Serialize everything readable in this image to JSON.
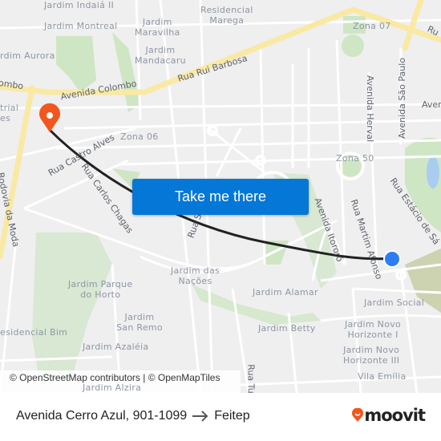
{
  "map": {
    "labels": {
      "indaia": "Jardim Indaiá II",
      "montreal": "Jardim Montreal",
      "maravilha": "Jardim\nMaravilha",
      "mandacaru": "Jardim\nMandacaru",
      "marega": "Residencial\nMarega",
      "aurora": "rdim Aurora",
      "industrial": "trial\nes",
      "zona07": "Zona 07",
      "zona06": "Zona 06",
      "zona50": "Zona 50",
      "nacoes": "Jardim das\nNações",
      "horto": "Jardim Parque\ndo Horto",
      "alamar": "Jardim Alamar",
      "social": "Jardim Social",
      "sanremo": "Jardim\nSan Remo",
      "bim": "esidencial Bim",
      "betty": "Jardim Betty",
      "horizonte1": "Jardim Novo\nHorizonte I",
      "azaleia": "Jardim Azaléia",
      "horizonte3": "Jardim Novo\nHorizonte III",
      "emilia": "Vila Emília",
      "alzira": "Jardim Alzira"
    },
    "streets": {
      "rui_barbosa": "Rua Rui Barbosa",
      "colombo": "Avenida Colombo",
      "colombo_left": "ombo",
      "ru_right": "Ru",
      "herval": "Avenida Herval",
      "sao_paulo": "Avenida São Paulo",
      "aven_right": "Aven",
      "castro_alves": "Rua Castro Alves",
      "rodovia_moda": "Rodovia da Moda",
      "carlos_chagas": "Rua Carlos Chagas",
      "estacio": "Rua Estácio de Sá",
      "martim": "Rua Martim Afonso",
      "itororo": "Avenida Itororó",
      "rua_mid": "Rua Sa",
      "rua_tu": "Rua Tu"
    },
    "origin_marker_color": "#2e7cf6",
    "destination_marker_color": "#f2561d",
    "route_color": "#222222",
    "attribution": "© OpenStreetMap contributors | © OpenMapTiles"
  },
  "cta": {
    "label": "Take me there",
    "color": "#0577d6"
  },
  "footer": {
    "origin": "Avenida Cerro Azul, 901-1099",
    "arrow_icon": "arrow-right-icon",
    "destination": "Feitep",
    "logo": "moovit"
  }
}
